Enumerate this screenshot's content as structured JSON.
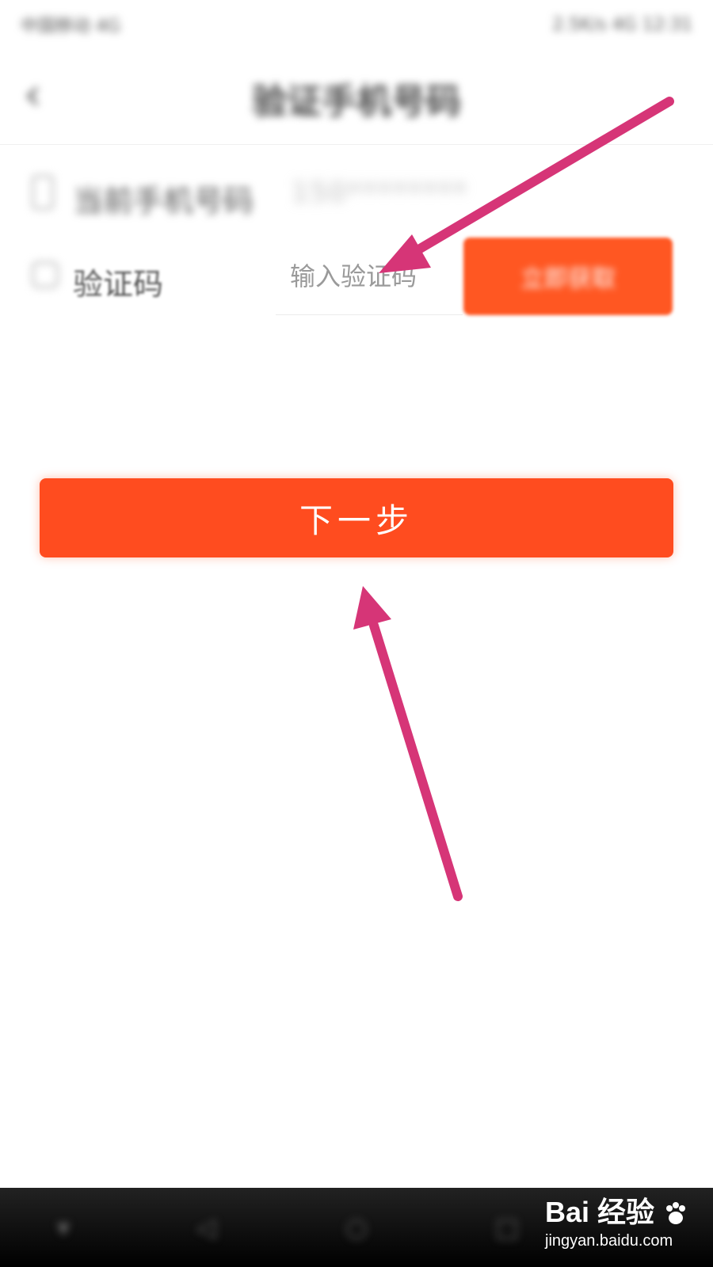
{
  "status_bar": {
    "carrier": "中国移动 4G",
    "right": "2.5K/s 4G 12:31"
  },
  "header": {
    "title": "验证手机号码"
  },
  "phone_row": {
    "label": "当前手机号码",
    "value": "150********"
  },
  "code_row": {
    "label": "验证码",
    "input_placeholder": "输入验证码",
    "button_label": "立即获取"
  },
  "next_button": {
    "label": "下一步"
  },
  "watermark": {
    "logo": "Bai 经验",
    "url": "jingyan.baidu.com"
  },
  "colors": {
    "accent": "#ff4c1f",
    "annotation": "#d63577"
  }
}
